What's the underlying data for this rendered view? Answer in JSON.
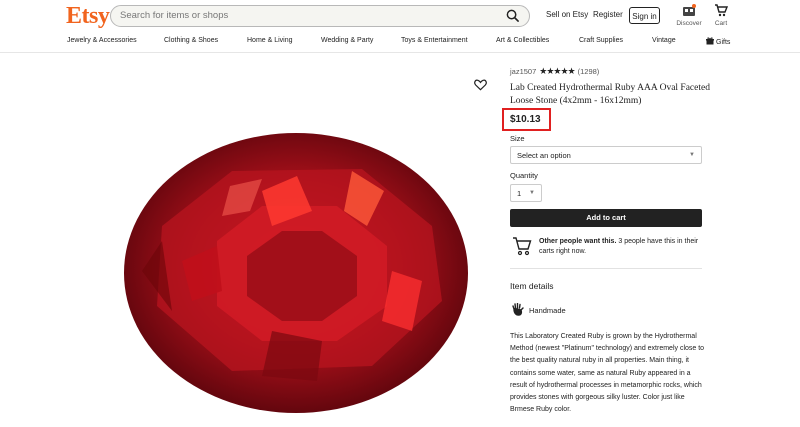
{
  "header": {
    "logo": "Etsy",
    "search_placeholder": "Search for items or shops",
    "sell_on_etsy": "Sell on Etsy",
    "register": "Register",
    "sign_in": "Sign in",
    "discover": "Discover",
    "cart": "Cart"
  },
  "nav": {
    "items": [
      "Jewelry & Accessories",
      "Clothing & Shoes",
      "Home & Living",
      "Wedding & Party",
      "Toys & Entertainment",
      "Art & Collectibles",
      "Craft Supplies",
      "Vintage",
      "Gifts"
    ]
  },
  "product": {
    "shop_name": "jaz1507",
    "stars": "★★★★★",
    "review_count": "(1298)",
    "title": "Lab Created Hydrothermal Ruby AAA Oval Faceted Loose Stone (4x2mm - 16x12mm)",
    "price": "$10.13",
    "size_label": "Size",
    "size_placeholder": "Select an option",
    "quantity_label": "Quantity",
    "quantity_value": "1",
    "add_to_cart": "Add to cart",
    "others_want_bold": "Other people want this.",
    "others_want_rest": " 3 people have this in their carts right now.",
    "item_details": "Item details",
    "handmade": "Handmade",
    "description": "This Laboratory Created Ruby is grown by the Hydrothermal Method (newest \"Platinum\" technology) and extremely close to the best quality natural ruby in all properties. Main thing, it contains some water, same as natural Ruby appeared in a result of hydrothermal processes in metamorphic rocks, which provides stones with gorgeous silky luster. Color just like Brmese Ruby color."
  },
  "colors": {
    "brand": "#f1641e",
    "highlight": "#e02020",
    "ruby": "#b3121b"
  }
}
